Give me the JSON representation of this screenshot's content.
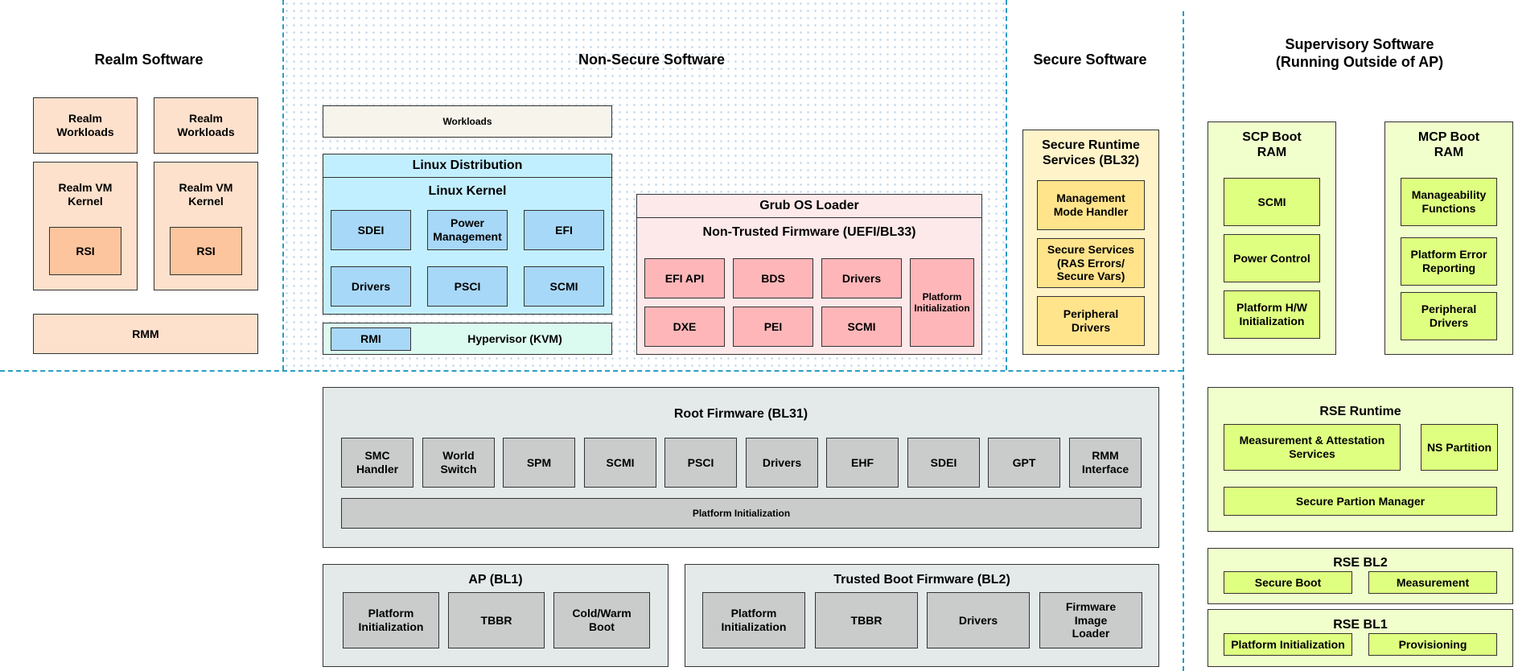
{
  "sections": {
    "realm": "Realm Software",
    "non_secure": "Non-Secure Software",
    "secure": "Secure Software",
    "supervisory": "Supervisory Software\n(Running Outside of AP)"
  },
  "realm": {
    "workloads_1": "Realm\nWorkloads",
    "workloads_2": "Realm\nWorkloads",
    "vm_kernel_1": "Realm VM\nKernel",
    "vm_kernel_2": "Realm VM\nKernel",
    "rsi_1": "RSI",
    "rsi_2": "RSI",
    "rmm": "RMM"
  },
  "non_secure": {
    "workloads": "Workloads",
    "linux_distribution": "Linux Distribution",
    "linux_kernel": "Linux Kernel",
    "kernel_items": [
      "SDEI",
      "Power\nManagement",
      "EFI",
      "Drivers",
      "PSCI",
      "SCMI"
    ],
    "rmi": "RMI",
    "hypervisor": "Hypervisor (KVM)",
    "grub": "Grub OS Loader",
    "non_trusted_fw": "Non-Trusted Firmware (UEFI/BL33)",
    "uefi_items": [
      "EFI API",
      "BDS",
      "Drivers",
      "DXE",
      "PEI",
      "SCMI"
    ],
    "platform_init": "Platform\nInitialization"
  },
  "secure": {
    "runtime": "Secure Runtime\nServices (BL32)",
    "items": [
      "Management\nMode Handler",
      "Secure Services\n(RAS Errors/\nSecure Vars)",
      "Peripheral\nDrivers"
    ]
  },
  "supervisory": {
    "scp": "SCP Boot\nRAM",
    "scp_items": [
      "SCMI",
      "Power Control",
      "Platform H/W\nInitialization"
    ],
    "mcp": "MCP Boot\nRAM",
    "mcp_items": [
      "Manageability\nFunctions",
      "Platform Error\nReporting",
      "Peripheral\nDrivers"
    ],
    "rse_runtime": "RSE Runtime",
    "measurement_attestation": "Measurement & Attestation\nServices",
    "ns_partition": "NS Partition",
    "secure_partition_manager": "Secure Partion Manager",
    "rse_bl2": "RSE BL2",
    "secure_boot": "Secure Boot",
    "measurement": "Measurement",
    "rse_bl1": "RSE BL1",
    "platform_initialization": "Platform Initialization",
    "provisioning": "Provisioning"
  },
  "root_fw": {
    "title": "Root Firmware (BL31)",
    "items": [
      "SMC\nHandler",
      "World\nSwitch",
      "SPM",
      "SCMI",
      "PSCI",
      "Drivers",
      "EHF",
      "SDEI",
      "GPT",
      "RMM\nInterface"
    ],
    "platform_init": "Platform Initialization"
  },
  "ap_bl1": {
    "title": "AP (BL1)",
    "items": [
      "Platform\nInitialization",
      "TBBR",
      "Cold/Warm\nBoot"
    ]
  },
  "tbf_bl2": {
    "title": "Trusted Boot Firmware (BL2)",
    "items": [
      "Platform\nInitialization",
      "TBBR",
      "Drivers",
      "Firmware\nImage\nLoader"
    ]
  }
}
